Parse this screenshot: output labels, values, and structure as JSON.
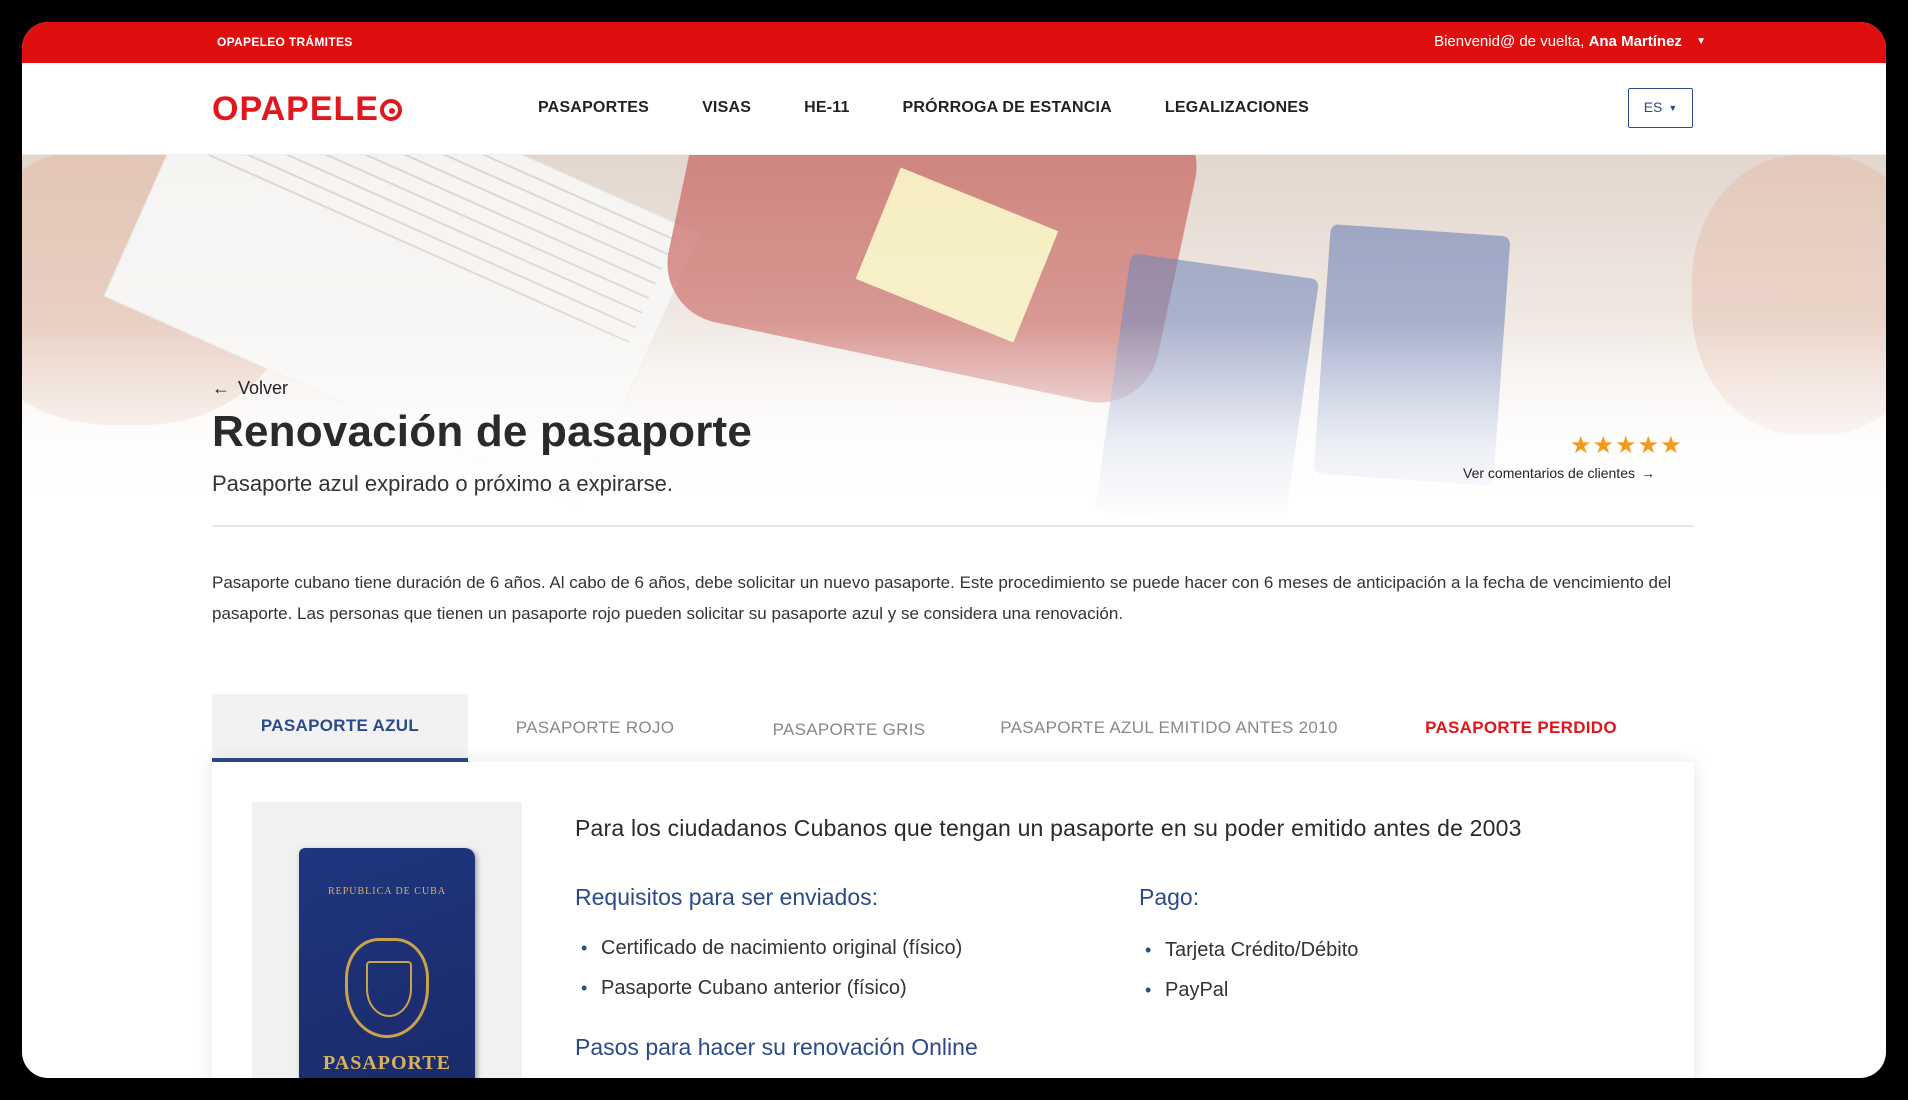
{
  "topbar": {
    "brand": "OPAPELEO TRÁMITES",
    "welcome_prefix": "Bienvenid@ de vuelta,",
    "user_name": "Ana Martínez"
  },
  "nav": {
    "logo": "OPAPELE",
    "items": [
      "PASAPORTES",
      "VISAS",
      "HE-11",
      "PRÓRROGA DE ESTANCIA",
      "LEGALIZACIONES"
    ],
    "language": "ES"
  },
  "hero": {
    "back_label": "Volver",
    "title": "Renovación de pasaporte",
    "subtitle": "Pasaporte azul expirado o próximo a expirarse.",
    "rating_stars": 5,
    "stars_text": "★★★★★",
    "reviews_link": "Ver comentarios de clientes"
  },
  "intro": "Pasaporte cubano tiene duración de 6 años. Al cabo de 6 años, debe solicitar un nuevo pasaporte. Este procedimiento se puede hacer con 6 meses de anticipación a la fecha de vencimiento del pasaporte. Las personas que tienen un pasaporte rojo pueden solicitar su pasaporte azul y se considera una renovación.",
  "tabs": [
    {
      "label": "PASAPORTE AZUL"
    },
    {
      "label": "PASAPORTE ROJO"
    },
    {
      "label": "PASAPORTE GRIS"
    },
    {
      "label": "PASAPORTE AZUL EMITIDO ANTES 2010"
    },
    {
      "label": "PASAPORTE PERDIDO"
    }
  ],
  "card": {
    "passport_country": "REPUBLICA DE CUBA",
    "passport_word": "PASAPORTE",
    "title": "Para los ciudadanos Cubanos que tengan un pasaporte en su poder emitido antes de 2003",
    "requirements_title": "Requisitos para ser enviados:",
    "requirements": [
      "Certificado de nacimiento original (físico)",
      "Pasaporte Cubano anterior (físico)"
    ],
    "payment_title": "Pago:",
    "payment": [
      "Tarjeta Crédito/Débito",
      "PayPal"
    ],
    "steps_title": "Pasos para hacer su renovación Online"
  },
  "colors": {
    "brand_red": "#e00f0f",
    "accent_blue": "#2b4a8a",
    "star_orange": "#f39a1b"
  }
}
